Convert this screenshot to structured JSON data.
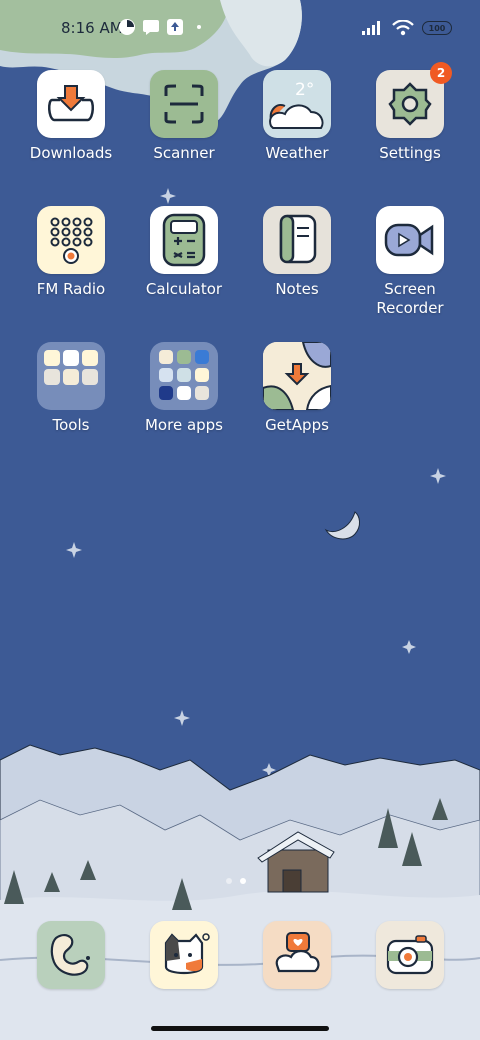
{
  "status_bar": {
    "time": "8:16 AM",
    "battery": "100"
  },
  "apps": [
    {
      "name": "downloads",
      "label": "Downloads",
      "bg": "#ffffff"
    },
    {
      "name": "scanner",
      "label": "Scanner",
      "bg": "#9cbb93"
    },
    {
      "name": "weather",
      "label": "Weather",
      "bg": "#cfe0e6",
      "temp": "2°"
    },
    {
      "name": "settings",
      "label": "Settings",
      "bg": "#e8e4dc",
      "badge": "2"
    },
    {
      "name": "fm-radio",
      "label": "FM Radio",
      "bg": "#fff6d8"
    },
    {
      "name": "calculator",
      "label": "Calculator",
      "bg": "#ffffff"
    },
    {
      "name": "notes",
      "label": "Notes",
      "bg": "#e6e2da"
    },
    {
      "name": "screen-recorder",
      "label": "Screen Recorder",
      "bg": "#ffffff"
    },
    {
      "name": "tools",
      "label": "Tools"
    },
    {
      "name": "more-apps",
      "label": "More apps"
    },
    {
      "name": "getapps",
      "label": "GetApps",
      "bg": "#f5ecd8"
    }
  ],
  "dock": [
    {
      "name": "phone",
      "icon": "phone-icon",
      "bg": "#b9d0bc"
    },
    {
      "name": "contacts",
      "icon": "cat-face-icon",
      "bg": "#fff6d8"
    },
    {
      "name": "messages",
      "icon": "message-heart-icon",
      "bg": "#f5dcc4"
    },
    {
      "name": "camera",
      "icon": "camera-icon",
      "bg": "#efe8dc"
    }
  ],
  "colors": {
    "sky": "#3d5a95",
    "snow": "#c9d3e3",
    "accent": "#f05a23"
  }
}
